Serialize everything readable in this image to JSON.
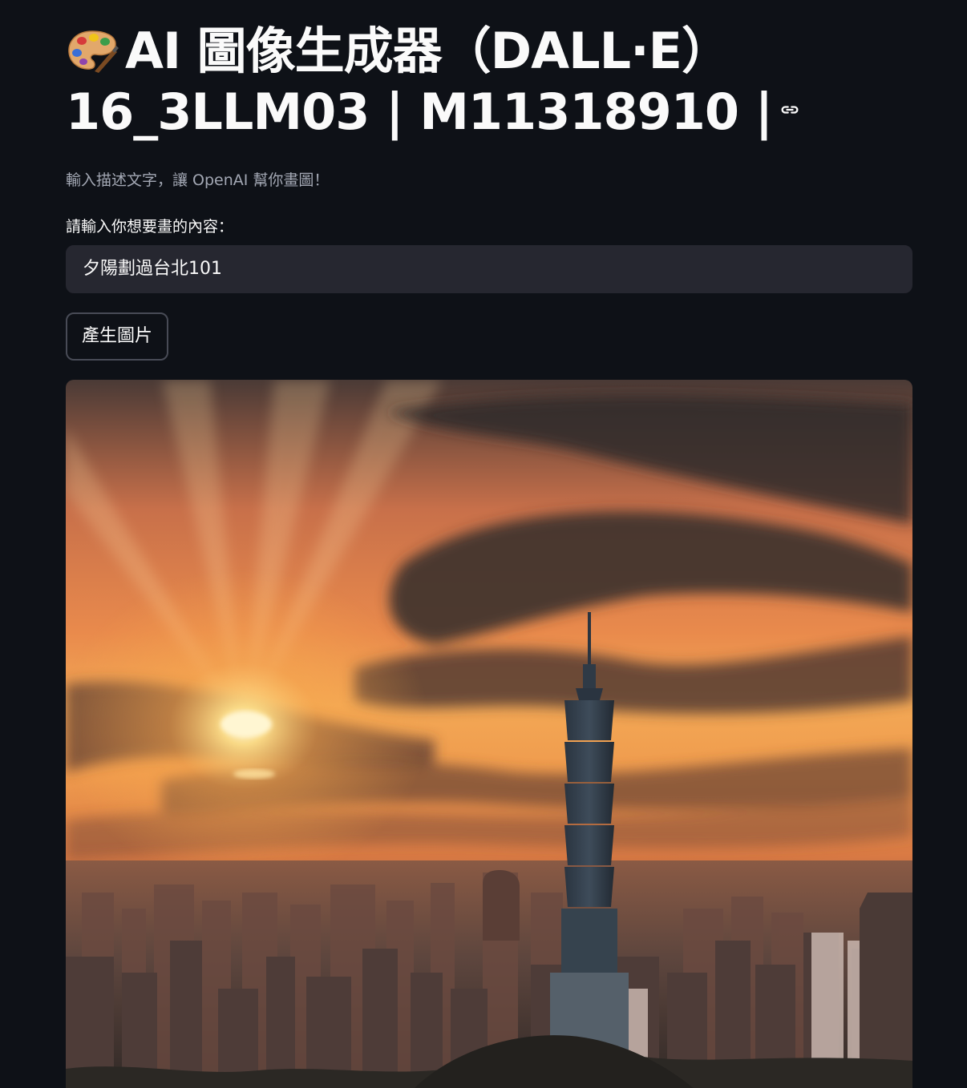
{
  "header": {
    "palette_icon": "artist-palette-icon",
    "title_line1": "AI 圖像生成器（DALL·E）",
    "title_line2": "16_3LLM03 | M11318910 |",
    "anchor_icon": "link-icon"
  },
  "caption": "輸入描述文字，讓 OpenAI 幫你畫圖！",
  "prompt": {
    "label": "請輸入你想要畫的內容：",
    "value": "夕陽劃過台北101"
  },
  "generate_button": {
    "label": "產生圖片"
  },
  "generated_image": {
    "subject": "sunset over Taipei 101 skyline"
  },
  "colors": {
    "background": "#0e1117",
    "input_background": "#262730",
    "caption_text": "#a3a8b4",
    "button_border": "#484b56"
  }
}
